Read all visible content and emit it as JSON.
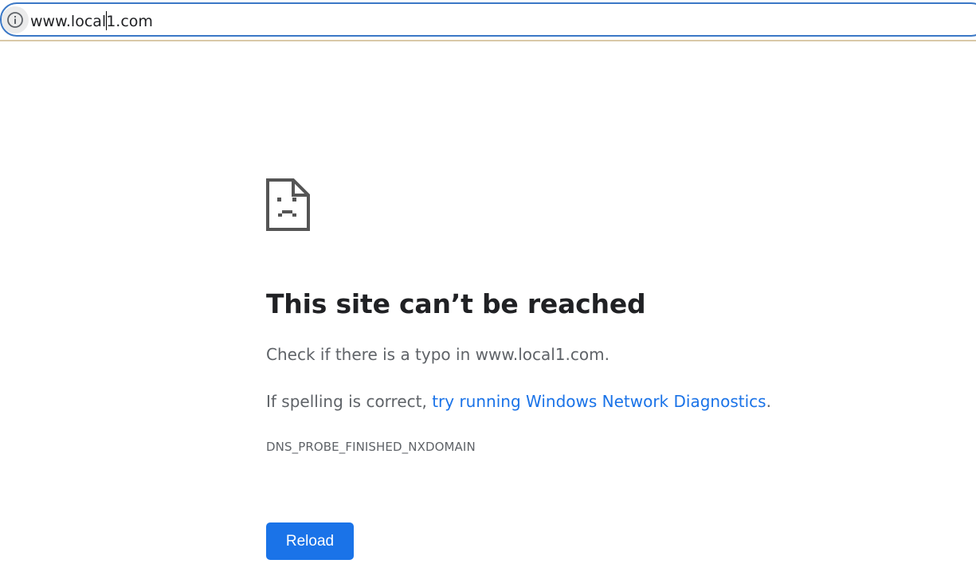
{
  "omnibox": {
    "url_before_cursor": "www.local",
    "url_after_cursor": "1.com",
    "info_icon": "info-icon"
  },
  "error_page": {
    "icon": "sad-document-icon",
    "headline": "This site can’t be reached",
    "check_text": "Check if there is a typo in www.local1.com.",
    "spelling_prefix": "If spelling is correct, ",
    "diagnostics_link": "try running Windows Network Diagnostics",
    "spelling_suffix": ".",
    "error_code": "DNS_PROBE_FINISHED_NXDOMAIN",
    "reload_label": "Reload"
  },
  "colors": {
    "accent": "#1a73e8",
    "omnibox_border": "#3b78c6",
    "body_text": "#5f6368",
    "headline_text": "#202124"
  }
}
